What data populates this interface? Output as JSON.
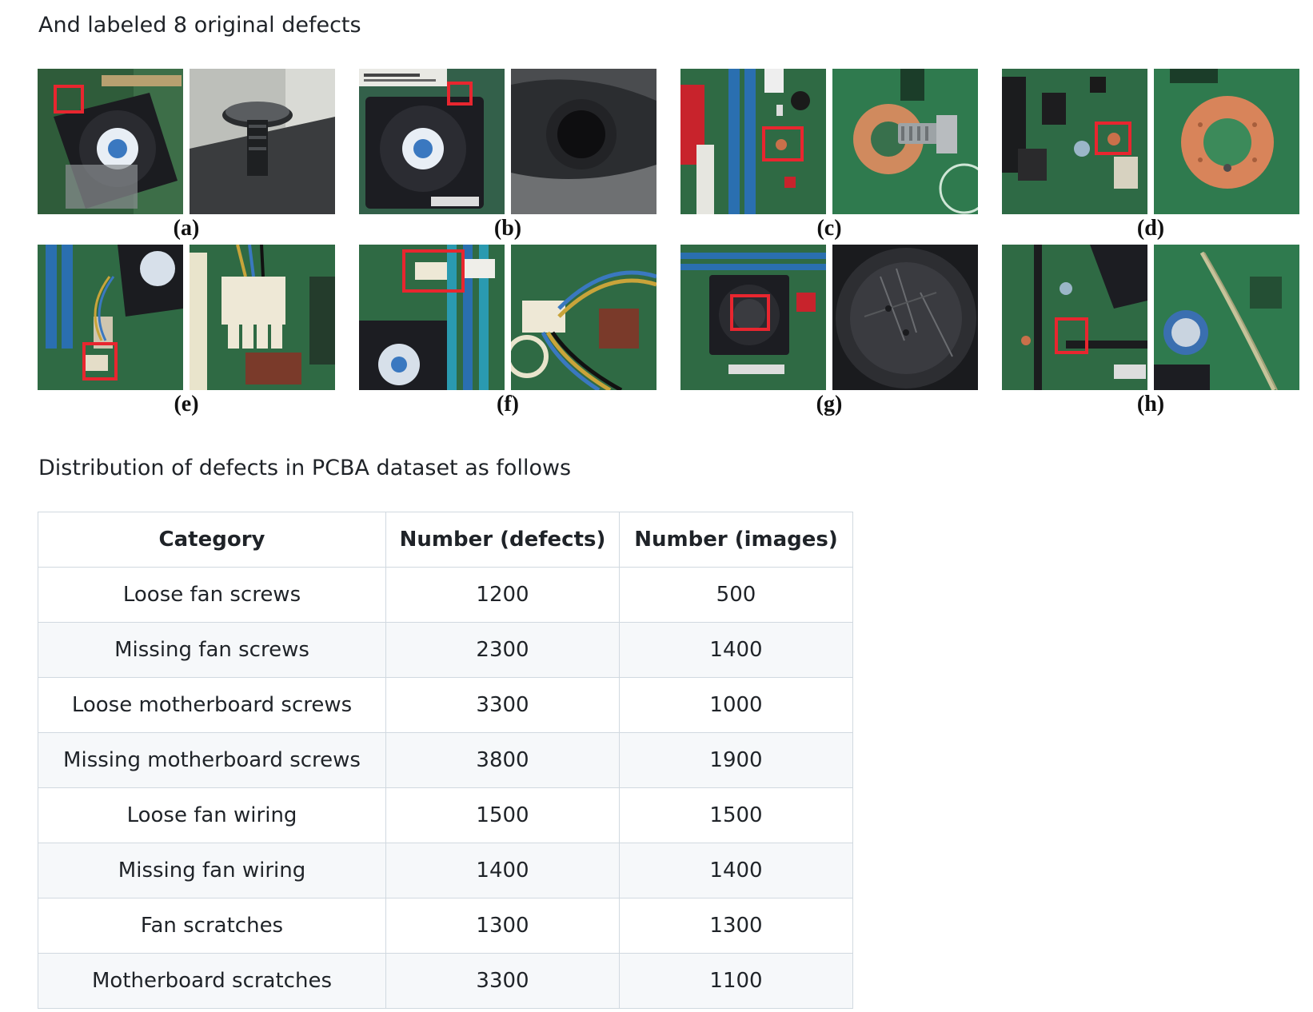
{
  "intro_heading": "And labeled 8 original defects",
  "figure": {
    "panels": [
      {
        "label": "(a)",
        "defect_icon": "screw-head"
      },
      {
        "label": "(b)",
        "defect_icon": "empty-screw-hole"
      },
      {
        "label": "(c)",
        "defect_icon": "board-screw-washer"
      },
      {
        "label": "(d)",
        "defect_icon": "empty-washer-hole"
      },
      {
        "label": "(e)",
        "defect_icon": "connector-unplugged"
      },
      {
        "label": "(f)",
        "defect_icon": "connector-wires"
      },
      {
        "label": "(g)",
        "defect_icon": "fan-scratch"
      },
      {
        "label": "(h)",
        "defect_icon": "board-scratch"
      }
    ],
    "highlight_color": "#e8262f"
  },
  "table_heading": "Distribution of defects in PCBA dataset as follows",
  "table": {
    "headers": [
      "Category",
      "Number (defects)",
      "Number (images)"
    ],
    "rows": [
      [
        "Loose fan screws",
        "1200",
        "500"
      ],
      [
        "Missing fan screws",
        "2300",
        "1400"
      ],
      [
        "Loose motherboard screws",
        "3300",
        "1000"
      ],
      [
        "Missing motherboard screws",
        "3800",
        "1900"
      ],
      [
        "Loose fan wiring",
        "1500",
        "1500"
      ],
      [
        "Missing fan wiring",
        "1400",
        "1400"
      ],
      [
        "Fan scratches",
        "1300",
        "1300"
      ],
      [
        "Motherboard scratches",
        "3300",
        "1100"
      ]
    ]
  }
}
